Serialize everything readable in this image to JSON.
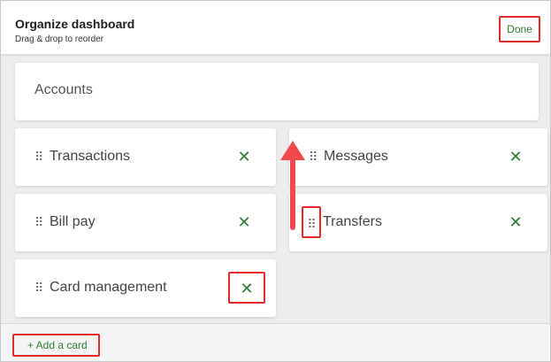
{
  "header": {
    "title": "Organize dashboard",
    "subtitle": "Drag & drop to reorder",
    "done_label": "Done"
  },
  "cards": {
    "accounts": {
      "label": "Accounts"
    },
    "transactions": {
      "label": "Transactions",
      "handle": "⠿",
      "remove": "✕"
    },
    "messages": {
      "label": "Messages",
      "handle": "⠿",
      "remove": "✕"
    },
    "bill_pay": {
      "label": "Bill pay",
      "handle": "⠿",
      "remove": "✕"
    },
    "transfers": {
      "label": "Transfers",
      "handle": "⠿",
      "remove": "✕"
    },
    "card_management": {
      "label": "Card management",
      "handle": "⠿",
      "remove": "✕"
    }
  },
  "footer": {
    "add_card_label": "+ Add a card"
  },
  "colors": {
    "accent_green": "#2e7d32",
    "highlight_red": "#e02b2b",
    "arrow_red": "#f04a4a"
  },
  "icons": {
    "handle": "drag-handle-icon",
    "remove": "close-icon",
    "arrow": "up-arrow-icon"
  }
}
